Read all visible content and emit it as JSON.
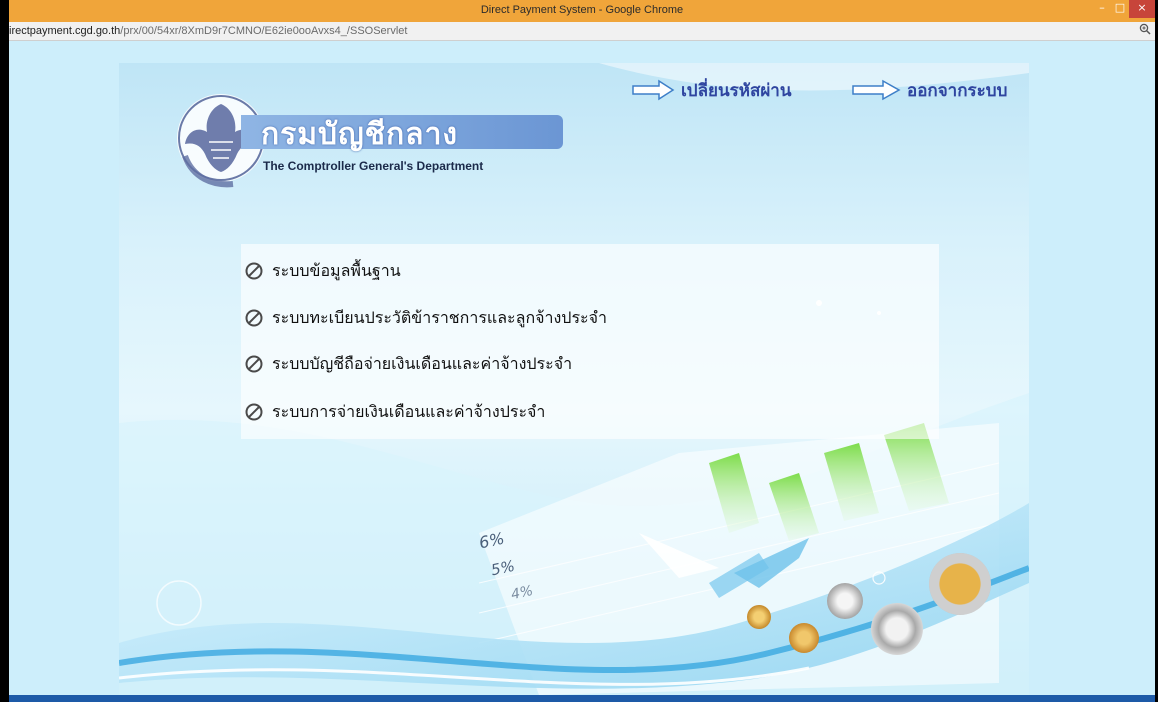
{
  "window": {
    "title": "Direct Payment System - Google Chrome",
    "minimize_symbol": "–",
    "maximize_symbol": "□",
    "close_symbol": "×"
  },
  "address_bar": {
    "host": "irectpayment.cgd.go.th",
    "path": "/prx/00/54xr/8XmD9r7CMNO/E62ie0ooAvxs4_/SSOServlet",
    "zoom_icon": "zoom-icon"
  },
  "header": {
    "department_thai": "กรมบัญชีกลาง",
    "department_english": "The Comptroller General's Department",
    "links": [
      {
        "label": "เปลี่ยนรหัสผ่าน",
        "icon": "arrow-right-icon"
      },
      {
        "label": "ออกจากระบบ",
        "icon": "arrow-right-icon"
      }
    ]
  },
  "menu": {
    "icon": "no-entry-icon",
    "items": [
      {
        "label": "ระบบข้อมูลพื้นฐาน"
      },
      {
        "label": "ระบบทะเบียนประวัติข้าราชการและลูกจ้างประจำ"
      },
      {
        "label": "ระบบบัญชีถือจ่ายเงินเดือนและค่าจ้างประจำ"
      },
      {
        "label": "ระบบการจ่ายเงินเดือนและค่าจ้างประจำ"
      }
    ]
  },
  "decoration": {
    "percent_labels": [
      "6%",
      "5%",
      "4%"
    ]
  },
  "colors": {
    "titlebar": "#f0a53a",
    "close_button": "#c7453a",
    "link_text": "#2f45a0",
    "banner": "#7aa3dc"
  }
}
